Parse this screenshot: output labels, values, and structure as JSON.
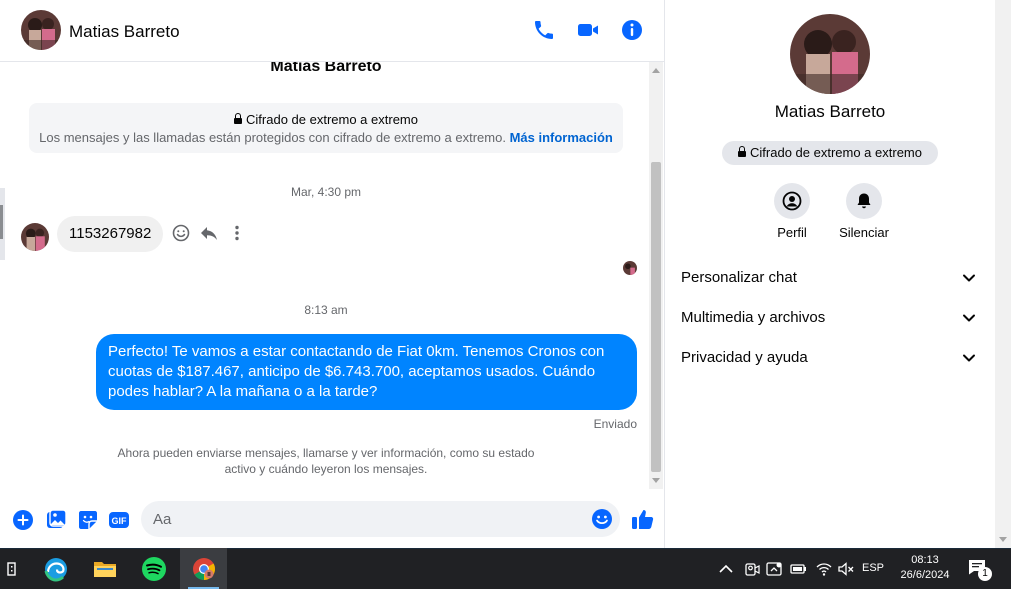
{
  "contact": {
    "name": "Matias Barreto"
  },
  "header": {
    "name": "Matias Barreto"
  },
  "encryption": {
    "title": "Cifrado de extremo a extremo",
    "description": "Los mensajes y las llamadas están protegidos con cifrado de extremo a extremo.",
    "link": "Más información"
  },
  "messages": {
    "timestamp_1": "Mar, 4:30 pm",
    "incoming_text": "1153267982",
    "timestamp_2": "8:13 am",
    "outgoing_text": "Perfecto! Te vamos a estar contactando de Fiat 0km. Tenemos Cronos con cuotas de $187.467, anticipo de $6.743.700, aceptamos usados. Cuándo podes hablar? A la mañana o a la tarde?",
    "outgoing_status": "Enviado",
    "info_note": "Ahora pueden enviarse mensajes, llamarse y ver información, como su estado activo y cuándo leyeron los mensajes."
  },
  "composer": {
    "placeholder": "Aa"
  },
  "info_panel": {
    "name": "Matias Barreto",
    "e2e_label": "Cifrado de extremo a extremo",
    "profile_label": "Perfil",
    "mute_label": "Silenciar",
    "sections": [
      {
        "label": "Personalizar chat"
      },
      {
        "label": "Multimedia y archivos"
      },
      {
        "label": "Privacidad y ayuda"
      }
    ]
  },
  "taskbar": {
    "apps": [
      "task-view",
      "edge",
      "file-explorer",
      "spotify",
      "chrome"
    ],
    "language": "ESP",
    "time": "08:13",
    "date": "26/6/2024",
    "notification_count": "1"
  },
  "colors": {
    "messenger_blue": "#0084ff",
    "icon_blue": "#0866ff",
    "link_blue": "#0064d1",
    "bubble_gray": "#f0f0f0",
    "taskbar_bg": "#202124"
  }
}
